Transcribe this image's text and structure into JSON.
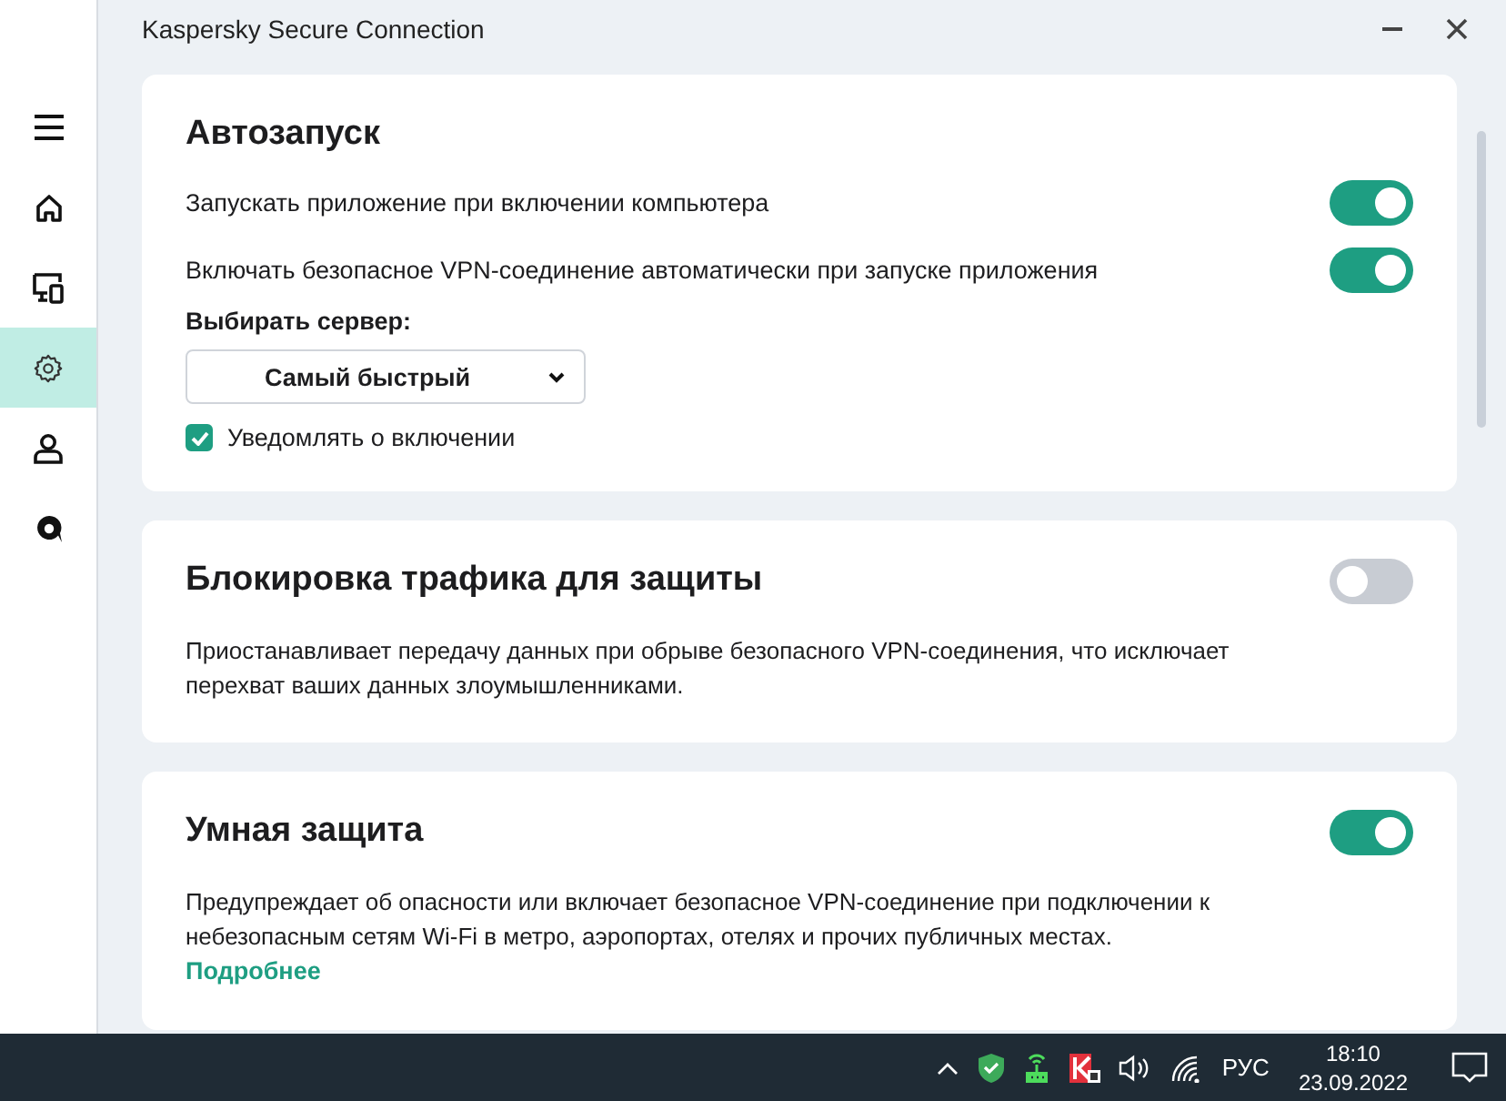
{
  "window": {
    "title": "Kaspersky Secure Connection"
  },
  "sidebar": {
    "items": [
      {
        "kind": "menu",
        "selected": false
      },
      {
        "kind": "home",
        "selected": false
      },
      {
        "kind": "devices",
        "selected": false
      },
      {
        "kind": "settings",
        "selected": true
      },
      {
        "kind": "account",
        "selected": false
      },
      {
        "kind": "support",
        "selected": false
      }
    ]
  },
  "sections": [
    {
      "title": "Автозапуск",
      "rows": [
        {
          "kind": "toggle",
          "label": "Запускать приложение при включении компьютера",
          "on": true
        },
        {
          "kind": "toggle",
          "label": "Включать безопасное VPN-соединение автоматически при запуске приложения",
          "on": true
        },
        {
          "kind": "label",
          "label": "Выбирать сервер:"
        },
        {
          "kind": "dropdown",
          "value": "Самый быстрый"
        },
        {
          "kind": "checkbox",
          "label": "Уведомлять о включении",
          "checked": true
        }
      ]
    },
    {
      "title": "Блокировка трафика для защиты",
      "on": false,
      "description": "Приостанавливает передачу данных при обрыве безопасного VPN-соединения, что исключает перехват ваших данных злоумышленниками."
    },
    {
      "title": "Умная защита",
      "on": true,
      "description": "Предупреждает об опасности или включает безопасное VPN-соединение при подключении к небезопасным сетям Wi-Fi в метро, аэропортах, отелях и прочих публичных местах.",
      "link": "Подробнее"
    }
  ],
  "taskbar": {
    "language": "РУС",
    "time": "18:10",
    "date": "23.09.2022"
  }
}
